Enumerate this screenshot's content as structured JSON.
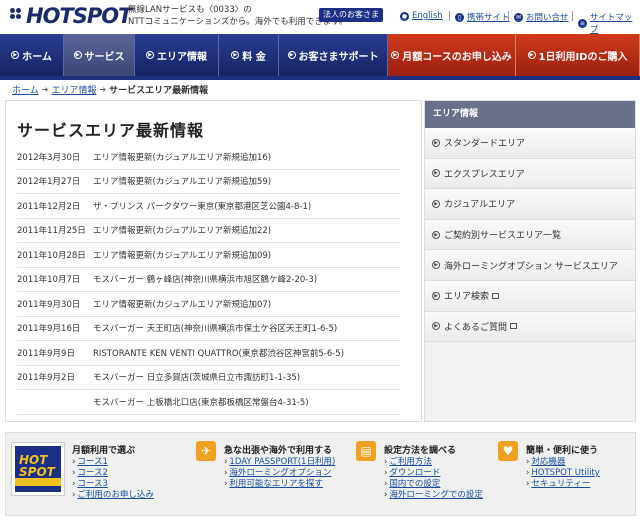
{
  "header": {
    "logo": "HOTSPOT",
    "tagline_1": "無線LANサービスも〈0033〉の",
    "tagline_2": "NTTコミュニケーションズから。海外でも利用できます。",
    "corp_button": "法人のお客さま",
    "util": [
      {
        "label": "English",
        "icon": "globe-icon"
      },
      {
        "label": "携帯サイト",
        "icon": "mobile-icon"
      },
      {
        "label": "お問い合せ",
        "icon": "mail-icon"
      },
      {
        "label": "サイトマップ",
        "icon": "sitemap-icon"
      }
    ]
  },
  "nav": [
    {
      "label": "ホーム",
      "active": false,
      "red": false
    },
    {
      "label": "サービス",
      "active": true,
      "red": false
    },
    {
      "label": "エリア情報",
      "active": false,
      "red": false
    },
    {
      "label": "料 金",
      "active": false,
      "red": false
    },
    {
      "label": "お客さまサポート",
      "active": false,
      "red": false
    },
    {
      "label": "月額コースのお申し込み",
      "active": false,
      "red": true
    },
    {
      "label": "1日利用IDのご購入",
      "active": false,
      "red": true
    }
  ],
  "breadcrumb": {
    "home": "ホーム",
    "area": "エリア情報",
    "current": "サービスエリア最新情報"
  },
  "main": {
    "title": "サービスエリア最新情報",
    "news": [
      {
        "date": "2012年3月30日",
        "text": "エリア情報更新(カジュアルエリア新規追加16)"
      },
      {
        "date": "2012年1月27日",
        "text": "エリア情報更新(カジュアルエリア新規追加59)"
      },
      {
        "date": "2011年12月2日",
        "text": "ザ・プリンス パークタワー東京(東京都港区芝公園4-8-1)"
      },
      {
        "date": "2011年11月25日",
        "text": "エリア情報更新(カジュアルエリア新規追加22)"
      },
      {
        "date": "2011年10月28日",
        "text": "エリア情報更新(カジュアルエリア新規追加09)"
      },
      {
        "date": "2011年10月7日",
        "text": "モスバーガー 鶴ヶ峰店(神奈川県横浜市旭区鶴ケ峰2-20-3)"
      },
      {
        "date": "2011年9月30日",
        "text": "エリア情報更新(カジュアルエリア新規追加07)"
      },
      {
        "date": "2011年9月16日",
        "text": "モスバーガー 天王町店(神奈川県横浜市保土ケ谷区天王町1-6-5)"
      },
      {
        "date": "2011年9月9日",
        "text": "RISTORANTE KEN VENTI QUATTRO(東京都渋谷区神宮前5-6-5)"
      },
      {
        "date": "2011年9月2日",
        "text": "モスバーガー 日立多賀店(茨城県日立市諏訪町1-1-35)"
      },
      {
        "date": "",
        "text": "モスバーガー 上板橋北口店(東京都板橋区常盤台4-31-5)"
      }
    ]
  },
  "side": {
    "heading": "エリア情報",
    "items": [
      {
        "label": "スタンダードエリア",
        "window": false
      },
      {
        "label": "エクスプレスエリア",
        "window": false
      },
      {
        "label": "カジュアルエリア",
        "window": false
      },
      {
        "label": "ご契約別サービスエリア一覧",
        "window": false
      },
      {
        "label": "海外ローミングオプション サービスエリア",
        "window": false
      },
      {
        "label": "エリア検索",
        "window": true
      },
      {
        "label": "よくあるご質問",
        "window": true
      }
    ]
  },
  "bottom": {
    "monthly": {
      "title": "月額利用で選ぶ",
      "links": [
        "コース1",
        "コース2",
        "コース3",
        "ご利用のお申し込み"
      ]
    },
    "travel": {
      "title": "急な出張や海外で利用する",
      "links": [
        "1DAY PASSPORT(1日利用)",
        "海外ローミングオプション",
        "利用可能なエリアを探す"
      ]
    },
    "setup": {
      "title": "設定方法を調べる",
      "links": [
        "ご利用方法",
        "ダウンロード",
        "国内での設定",
        "海外ローミングでの設定"
      ]
    },
    "tools": {
      "title": "簡単・便利に使う",
      "links": [
        "対応機器",
        "HOTSPOT Utility",
        "セキュリティー"
      ]
    }
  },
  "colors": {
    "nav_blue": "#1f2f7f",
    "nav_red": "#c0301a",
    "link": "#1a4ea0",
    "badge_orange": "#f0a020"
  }
}
